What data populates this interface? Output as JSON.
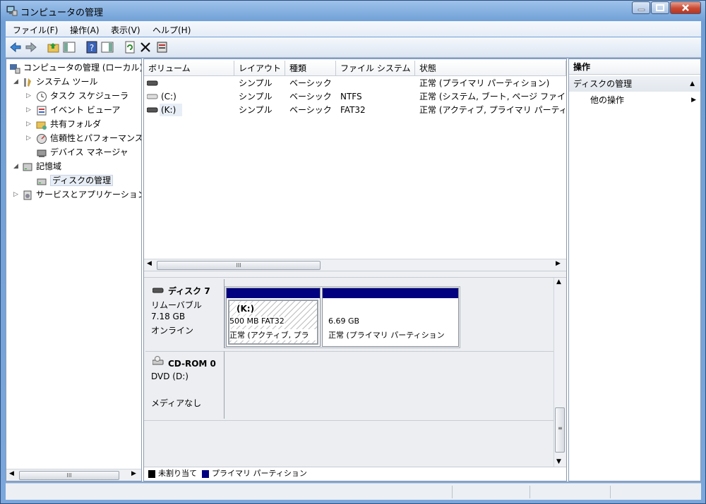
{
  "window": {
    "title": "コンピュータの管理"
  },
  "menu": [
    "ファイル(F)",
    "操作(A)",
    "表示(V)",
    "ヘルプ(H)"
  ],
  "toolbar_icons": [
    "back-arrow-icon",
    "forward-arrow-icon",
    "up-folder-icon",
    "show-hide-console-tree-icon",
    "help-icon",
    "show-hide-action-pane-icon",
    "refresh-icon",
    "delete-icon",
    "properties-icon"
  ],
  "tree": {
    "root": "コンピュータの管理 (ローカル)",
    "items": [
      {
        "label": "システム ツール",
        "level": 1,
        "expanded": true
      },
      {
        "label": "タスク スケジューラ",
        "level": 2
      },
      {
        "label": "イベント ビューア",
        "level": 2
      },
      {
        "label": "共有フォルダ",
        "level": 2
      },
      {
        "label": "信頼性とパフォーマンス",
        "level": 2
      },
      {
        "label": "デバイス マネージャ",
        "level": 2
      },
      {
        "label": "記憶域",
        "level": 1,
        "expanded": true
      },
      {
        "label": "ディスクの管理",
        "level": 2,
        "selected": true
      },
      {
        "label": "サービスとアプリケーション",
        "level": 1
      }
    ]
  },
  "volumes": {
    "columns": [
      "ボリューム",
      "レイアウト",
      "種類",
      "ファイル システム",
      "状態"
    ],
    "rows": [
      {
        "volume": "",
        "layout": "シンプル",
        "type": "ベーシック",
        "fs": "",
        "status": "正常 (プライマリ パーティション)"
      },
      {
        "volume": "(C:)",
        "layout": "シンプル",
        "type": "ベーシック",
        "fs": "NTFS",
        "status": "正常 (システム, ブート, ページ ファイル"
      },
      {
        "volume": "(K:)",
        "layout": "シンプル",
        "type": "ベーシック",
        "fs": "FAT32",
        "status": "正常 (アクティブ, プライマリ パーティ"
      }
    ]
  },
  "disks": [
    {
      "name": "ディスク 7",
      "kind": "リムーバブル",
      "size": "7.18 GB",
      "state": "オンライン",
      "partitions": [
        {
          "title": "(K:)",
          "size": "500 MB FAT32",
          "status": "正常 (アクティブ, プラ"
        },
        {
          "title": "",
          "size": "6.69 GB",
          "status": "正常 (プライマリ パーティション"
        }
      ]
    },
    {
      "name": "CD-ROM 0",
      "kind": "DVD (D:)",
      "size": "",
      "state": "メディアなし"
    }
  ],
  "legend": [
    {
      "label": "未割り当て",
      "color": "#000000"
    },
    {
      "label": "プライマリ パーティション",
      "color": "#000080"
    }
  ],
  "actions": {
    "header": "操作",
    "section": "ディスクの管理",
    "item": "他の操作"
  }
}
